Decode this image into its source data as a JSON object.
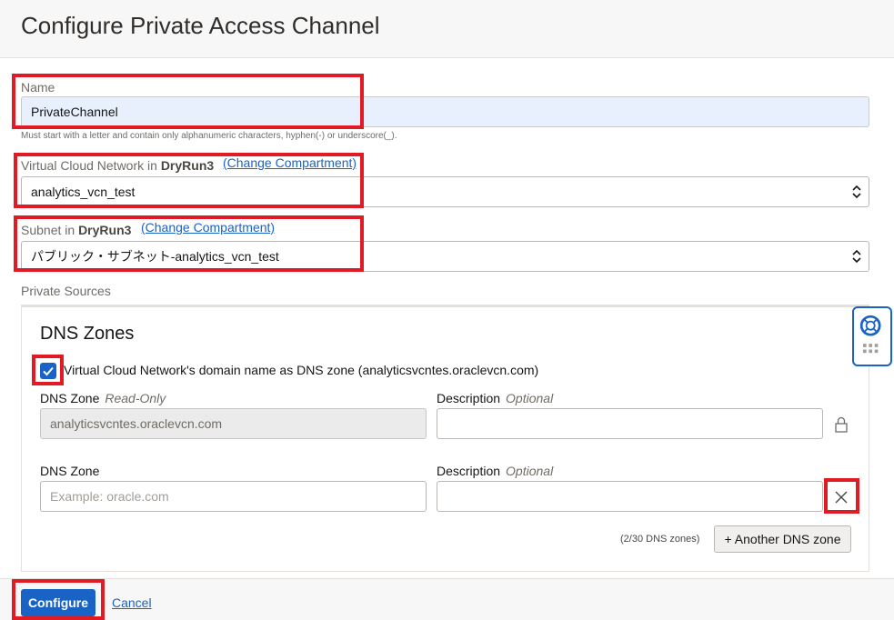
{
  "page": {
    "title": "Configure Private Access Channel"
  },
  "name_field": {
    "label": "Name",
    "value": "PrivateChannel",
    "hint": "Must start with a letter and contain only alphanumeric characters, hyphen(-) or underscore(_)."
  },
  "vcn_field": {
    "label_prefix": "Virtual Cloud Network in",
    "compartment": "DryRun3",
    "change_link": "(Change Compartment)",
    "value": "analytics_vcn_test"
  },
  "subnet_field": {
    "label_prefix": "Subnet in",
    "compartment": "DryRun3",
    "change_link": "(Change Compartment)",
    "value": "パブリック・サブネット-analytics_vcn_test"
  },
  "private_sources": {
    "label": "Private Sources",
    "panel_title": "DNS Zones",
    "checkbox_label": "Virtual Cloud Network's domain name as DNS zone (analyticsvcntes.oraclevcn.com)",
    "checkbox_checked": true,
    "zone1": {
      "zone_label": "DNS Zone",
      "zone_qualifier": "Read-Only",
      "zone_value": "analyticsvcntes.oraclevcn.com",
      "desc_label": "Description",
      "desc_qualifier": "Optional",
      "desc_value": ""
    },
    "zone2": {
      "zone_label": "DNS Zone",
      "zone_placeholder": "Example: oracle.com",
      "desc_label": "Description",
      "desc_qualifier": "Optional",
      "desc_value": ""
    },
    "counter": "(2/30 DNS zones)",
    "add_button": "+ Another DNS zone"
  },
  "footer": {
    "configure_label": "Configure",
    "cancel_label": "Cancel"
  },
  "colors": {
    "primary": "#1a63c6",
    "highlight_box": "#e01b24",
    "autofill_bg": "#e8f0fe"
  },
  "icons": {
    "select_chevron": "chevron-up-down-icon",
    "lock": "lock-icon",
    "remove": "close-icon",
    "help": "lifebuoy-icon",
    "apps": "grid-dots-icon",
    "check": "checkmark-icon"
  }
}
